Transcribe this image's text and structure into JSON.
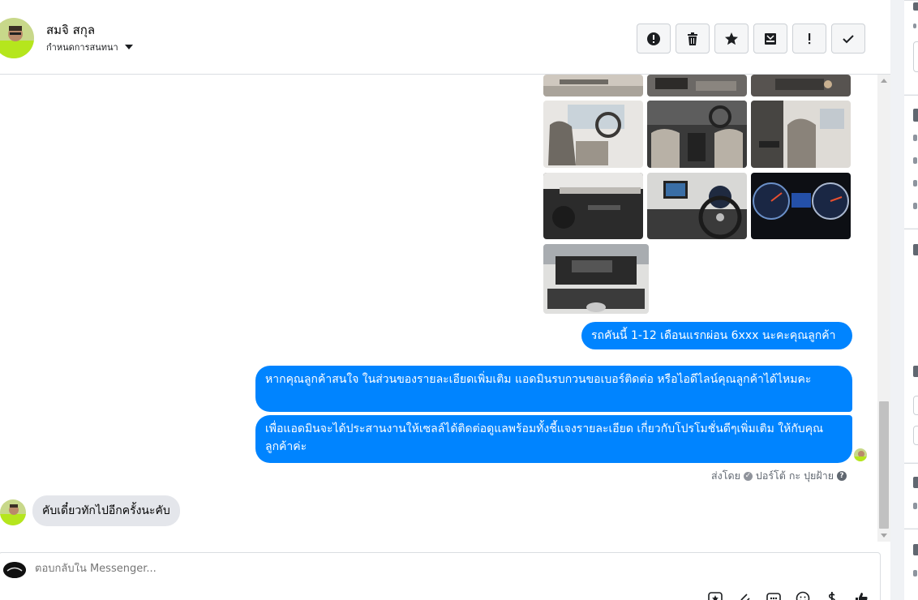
{
  "header": {
    "contact_name": "สมจิ สกุล",
    "conversation_setting": "กำหนดการสนทนา",
    "actions": [
      {
        "name": "report-spam-button",
        "icon": "alert-circle-icon"
      },
      {
        "name": "delete-button",
        "icon": "trash-icon"
      },
      {
        "name": "star-button",
        "icon": "star-icon"
      },
      {
        "name": "archive-button",
        "icon": "archive-icon"
      },
      {
        "name": "mark-important-button",
        "icon": "exclamation-icon"
      },
      {
        "name": "mark-done-button",
        "icon": "check-icon"
      }
    ]
  },
  "messages": {
    "out_1": "รถคันนี้ 1-12 เดือนแรกผ่อน 6xxx นะคะคุณลูกค้า",
    "out_2": "หากคุณลูกค้าสนใจ ในส่วนของรายละเอียดเพิ่มเติม แอดมินรบกวนขอเบอร์ติดต่อ หรือไอดีไลน์คุณลูกค้าได้ไหมคะ",
    "out_3": "เพื่อแอดมินจะได้ประสานงานให้เซลล์ได้ติดต่อดูแลพร้อมทั้งชี้แจงรายละเอียด เกี่ยวกับโปรโมชั่นดีๆเพิ่มเติม ให้กับคุณลูกค้าค่ะ",
    "sent_by_label": "ส่งโดย",
    "sent_by_name": "ปอร์โต้ กะ ปุยฝ้าย",
    "in_1": "คับเดี๋ยวทักไปอีกครั้งนะคับ"
  },
  "composer": {
    "placeholder": "ตอบกลับใน Messenger..."
  },
  "colors": {
    "accent": "#0084ff",
    "incoming_bubble": "#e4e6eb",
    "panel_bg": "#f0f2f5"
  }
}
